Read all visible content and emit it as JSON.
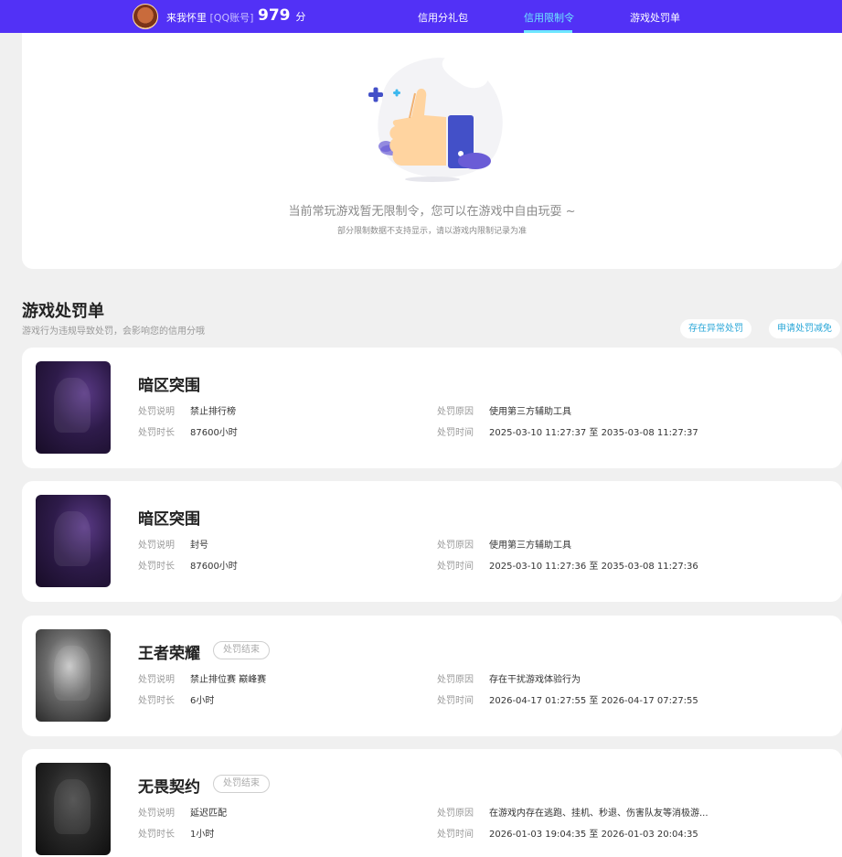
{
  "header": {
    "username": "来我怀里",
    "account_type": "[QQ账号]",
    "score": "979",
    "score_unit": "分",
    "tabs": [
      {
        "label": "信用分礼包"
      },
      {
        "label": "信用限制令"
      },
      {
        "label": "游戏处罚单"
      }
    ],
    "active_tab": "信用限制令",
    "colors": {
      "bar": "#5231f6",
      "active": "#6ee7ff"
    }
  },
  "restriction": {
    "illustration": "thumbs-up-icon",
    "message": "当前常玩游戏暂无限制令，您可以在游戏中自由玩耍 ~",
    "note": "部分限制数据不支持显示，请以游戏内限制记录为准"
  },
  "penalty_section": {
    "title": "游戏处罚单",
    "subtitle": "游戏行为违规导致处罚，会影响您的信用分哦",
    "abnormal_btn": "存在异常处罚",
    "appeal_btn": "申请处罚减免"
  },
  "penalty_labels": {
    "desc": "处罚说明",
    "reason": "处罚原因",
    "duration": "处罚时长",
    "time": "处罚时间"
  },
  "penalties": [
    {
      "game": "暗区突围",
      "status": "",
      "desc": "禁止排行榜",
      "reason": "使用第三方辅助工具",
      "duration": "87600小时",
      "time": "2025-03-10 11:27:37 至 2035-03-08 11:27:37"
    },
    {
      "game": "暗区突围",
      "status": "",
      "desc": "封号",
      "reason": "使用第三方辅助工具",
      "duration": "87600小时",
      "time": "2025-03-10 11:27:36 至 2035-03-08 11:27:36"
    },
    {
      "game": "王者荣耀",
      "status": "处罚结束",
      "desc": "禁止排位赛 巅峰赛",
      "reason": "存在干扰游戏体验行为",
      "duration": "6小时",
      "time": "2026-04-17 01:27:55 至 2026-04-17 07:27:55"
    },
    {
      "game": "无畏契约",
      "status": "处罚结束",
      "desc": "延迟匹配",
      "reason": "在游戏内存在逃跑、挂机、秒退、伤害队友等消极游...",
      "duration": "1小时",
      "time": "2026-01-03 19:04:35 至 2026-01-03 20:04:35"
    }
  ]
}
